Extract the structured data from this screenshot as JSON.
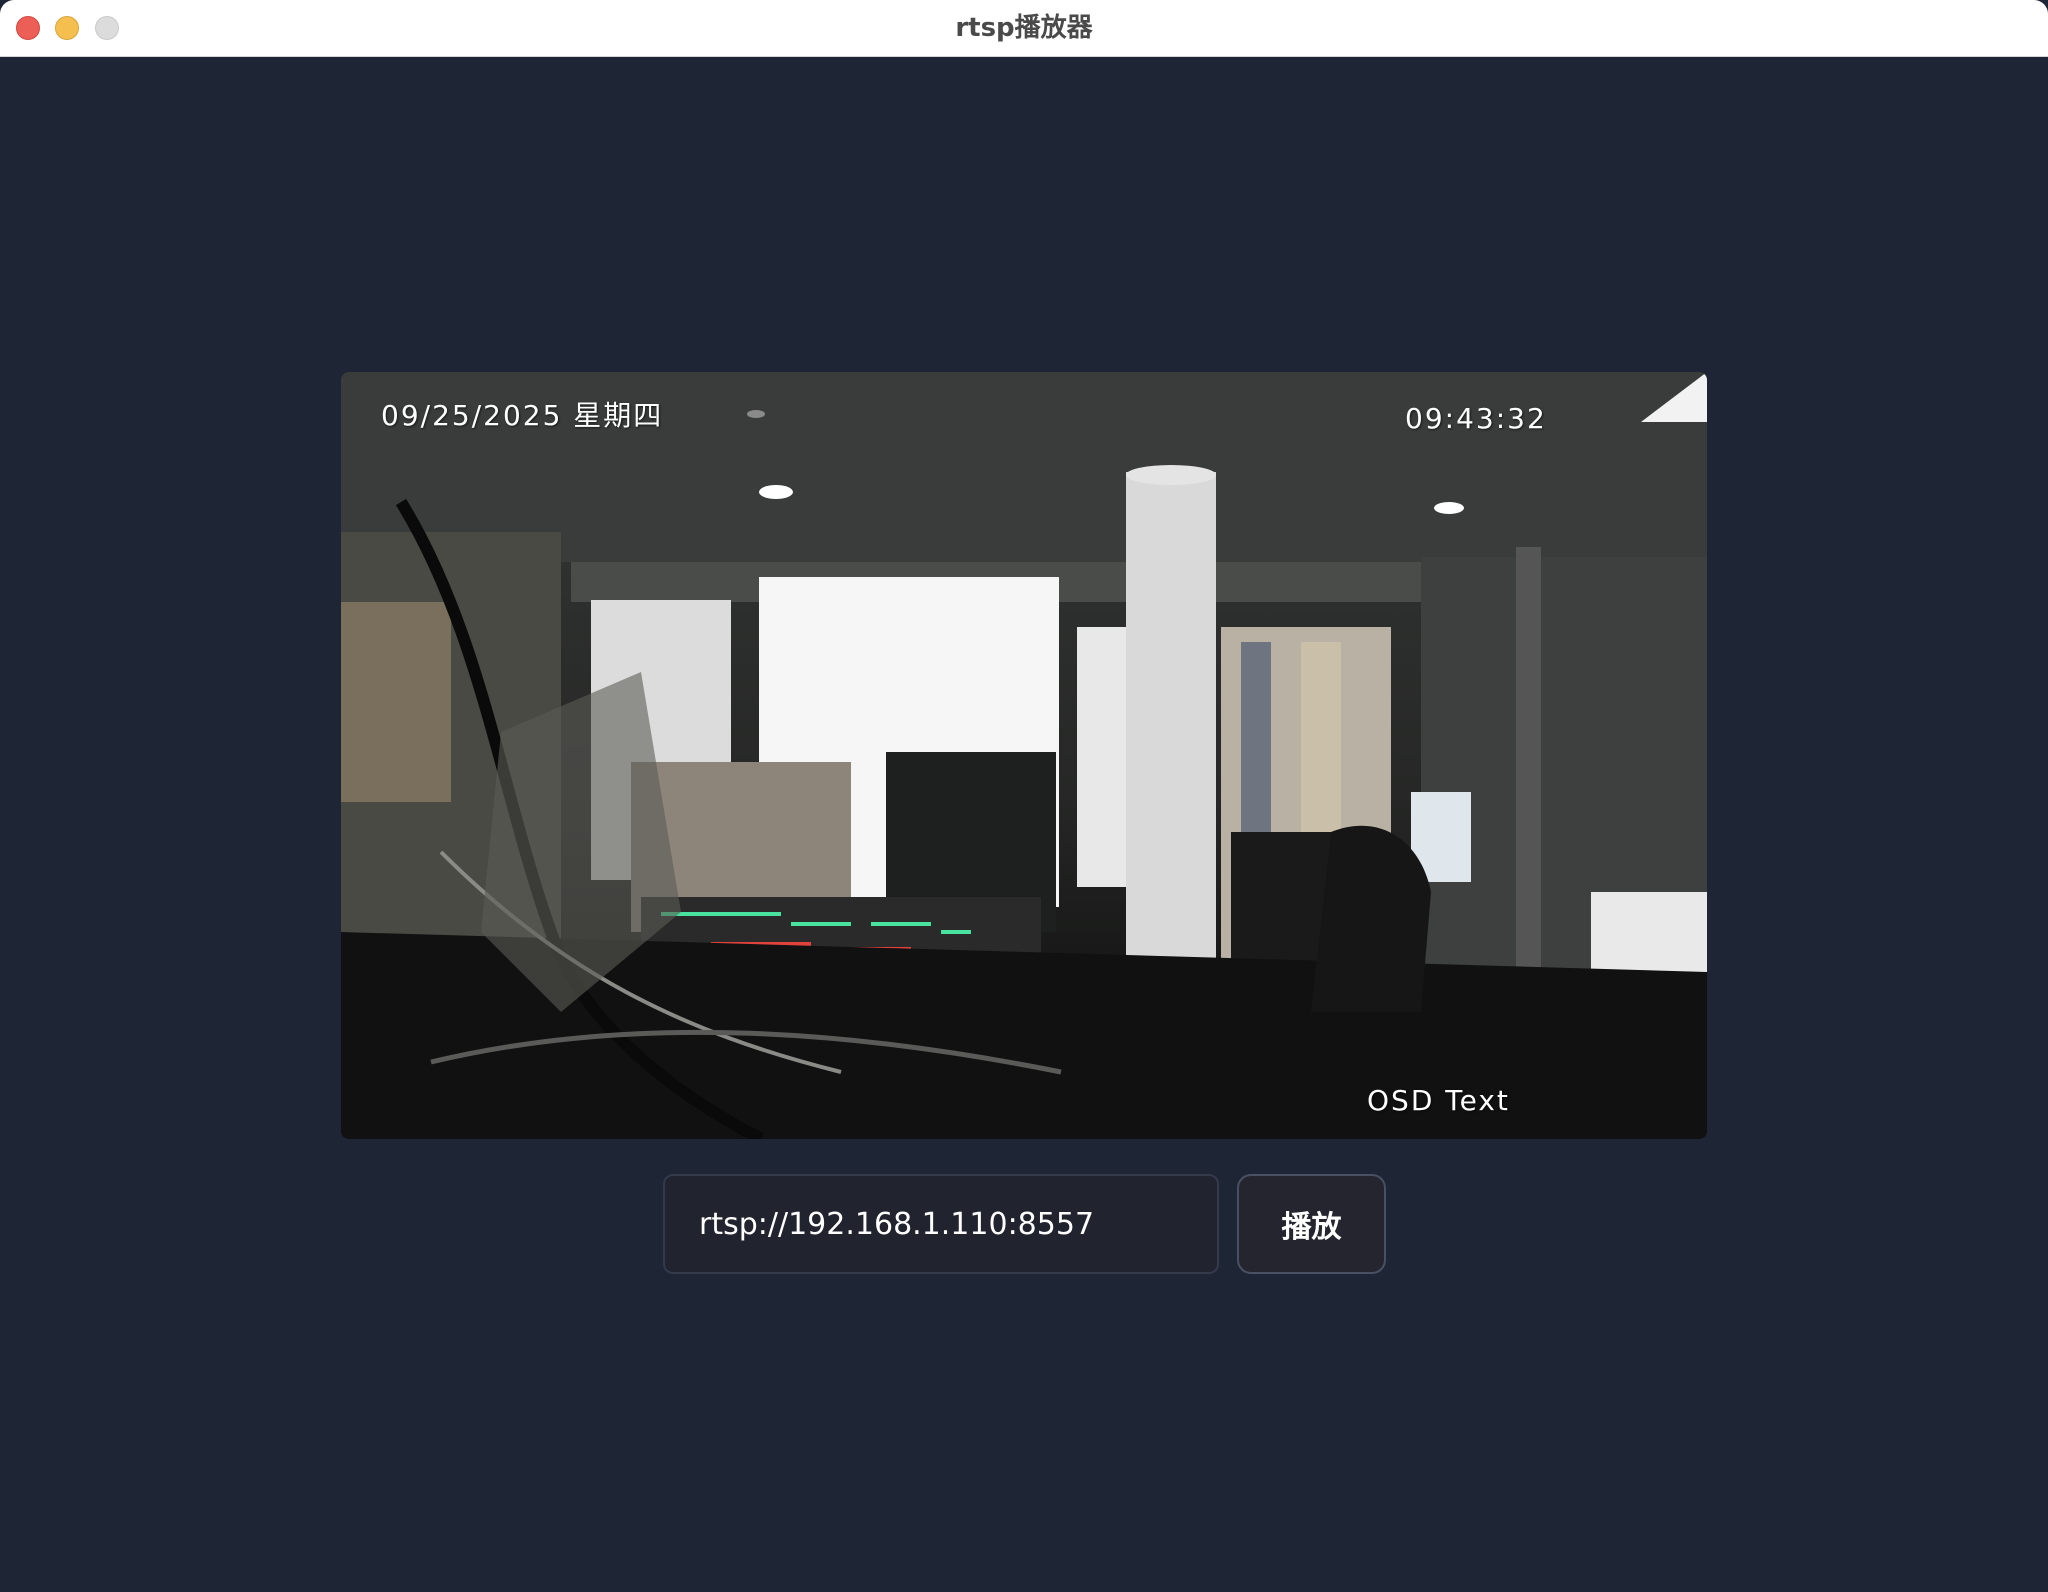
{
  "window": {
    "title": "rtsp播放器"
  },
  "video": {
    "osd_date": "09/25/2025 星期四",
    "osd_time": "09:43:32",
    "osd_text": "OSD Text"
  },
  "controls": {
    "url_value": "rtsp://192.168.1.110:8557",
    "play_label": "播放"
  },
  "colors": {
    "background": "#1e2535",
    "input_bg": "#21232e",
    "button_bg": "#24252e"
  }
}
